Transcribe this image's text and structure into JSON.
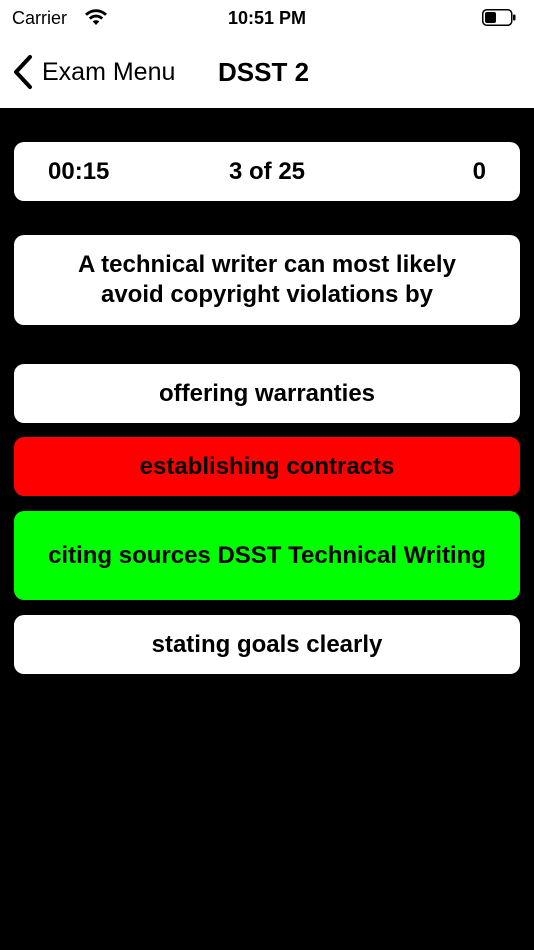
{
  "status_bar": {
    "carrier": "Carrier",
    "time": "10:51 PM"
  },
  "nav": {
    "back_label": "Exam Menu",
    "title": "DSST 2"
  },
  "stats": {
    "timer": "00:15",
    "progress": "3 of 25",
    "score": "0"
  },
  "question": {
    "text": "A technical writer can most likely avoid copyright violations by"
  },
  "answers": [
    {
      "text": "offering warranties",
      "state": "neutral",
      "color": "#ffffff"
    },
    {
      "text": "establishing contracts",
      "state": "incorrect",
      "color": "#ff0000"
    },
    {
      "text": "citing sources DSST Technical Writing",
      "state": "correct",
      "color": "#00ff00"
    },
    {
      "text": "stating goals clearly",
      "state": "neutral",
      "color": "#ffffff"
    }
  ],
  "colors": {
    "background": "#000000",
    "card": "#ffffff",
    "incorrect": "#ff0000",
    "correct": "#00ff00"
  }
}
